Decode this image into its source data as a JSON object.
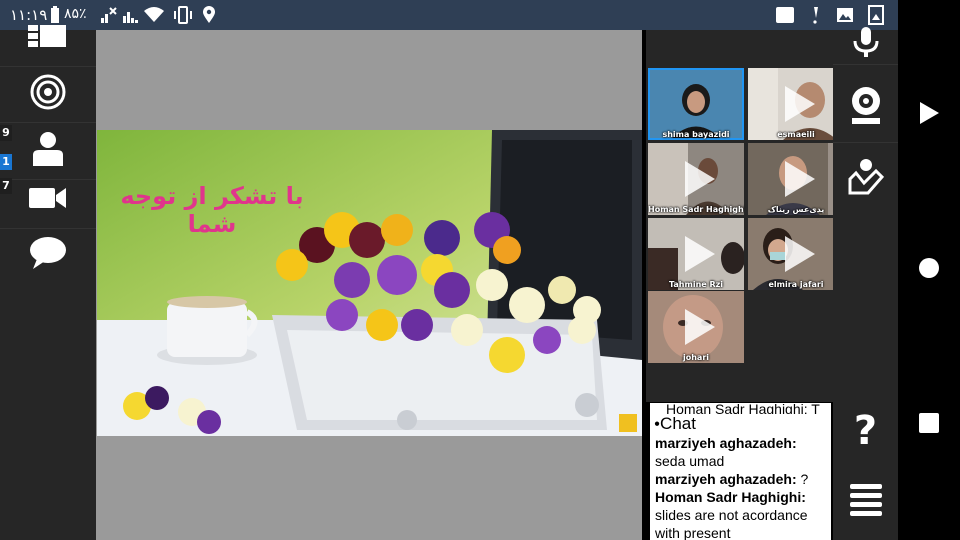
{
  "status_bar": {
    "time": "۱۱:۱۹",
    "battery": "۸۵٪"
  },
  "left_rail": {
    "badges": [
      "9",
      "1",
      "7"
    ]
  },
  "slide": {
    "text": "با تشکر از توجه شما"
  },
  "video_tiles": [
    {
      "name": "shima bayazidi",
      "active": true
    },
    {
      "name": "esmaeili",
      "active": false
    },
    {
      "name": "Homan Sadr Haghighi",
      "active": false
    },
    {
      "name": "یدی‌عس ریناک",
      "active": false
    },
    {
      "name": "Tahmine Rzi",
      "active": false
    },
    {
      "name": "elmira jafari",
      "active": false
    },
    {
      "name": "johari",
      "active": false
    }
  ],
  "chat": {
    "truncated_top": "Homan Sadr Haghighi: T",
    "header": "Chat",
    "messages": [
      {
        "author": "marziyeh aghazadeh",
        "text": "seda umad"
      },
      {
        "author": "marziyeh aghazadeh",
        "text": "?"
      },
      {
        "author": "Homan Sadr Haghighi",
        "text": "slides are not acordance with present"
      }
    ]
  },
  "colors": {
    "status_bar": "#2f3f55",
    "rail": "#262626",
    "stage": "#9a9a9a",
    "slide_text": "#e0358c",
    "active_tile": "#2196f3"
  }
}
